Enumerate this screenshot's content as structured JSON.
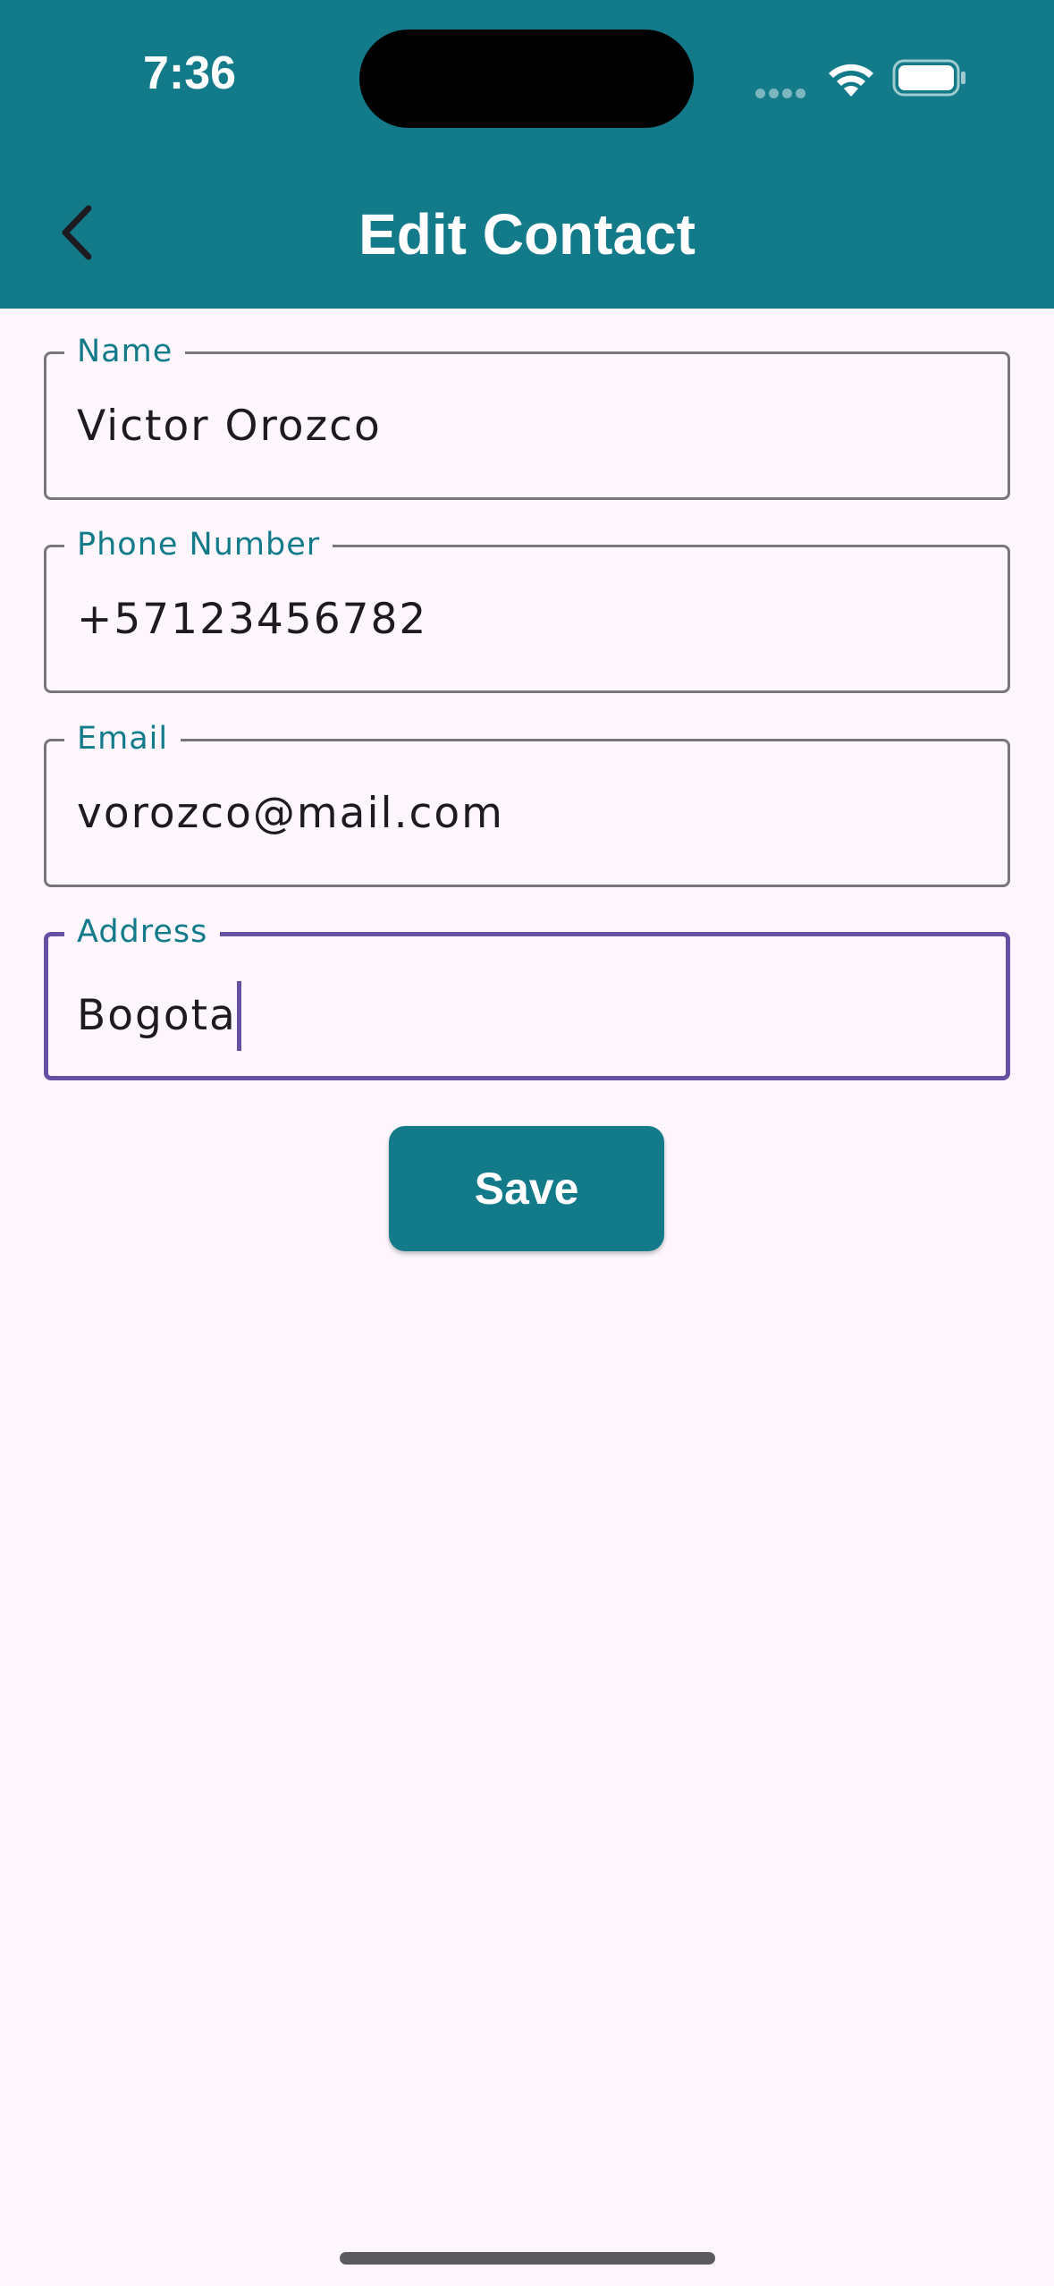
{
  "status_bar": {
    "time": "7:36",
    "icons": [
      "signal-icon",
      "wifi-icon",
      "battery-icon"
    ]
  },
  "header": {
    "title": "Edit Contact",
    "back_icon": "chevron-left-icon",
    "background": "#127a89"
  },
  "form": {
    "fields": [
      {
        "label": "Name",
        "value": "Victor Orozco",
        "focused": false
      },
      {
        "label": "Phone Number",
        "value": "+57123456782",
        "focused": false
      },
      {
        "label": "Email",
        "value": "vorozco@mail.com",
        "focused": false
      },
      {
        "label": "Address",
        "value": "Bogota",
        "focused": true
      }
    ],
    "save_label": "Save"
  },
  "colors": {
    "accent": "#127a89",
    "focus": "#6750a4",
    "background": "#fdf7fd",
    "outline": "#79747e"
  }
}
